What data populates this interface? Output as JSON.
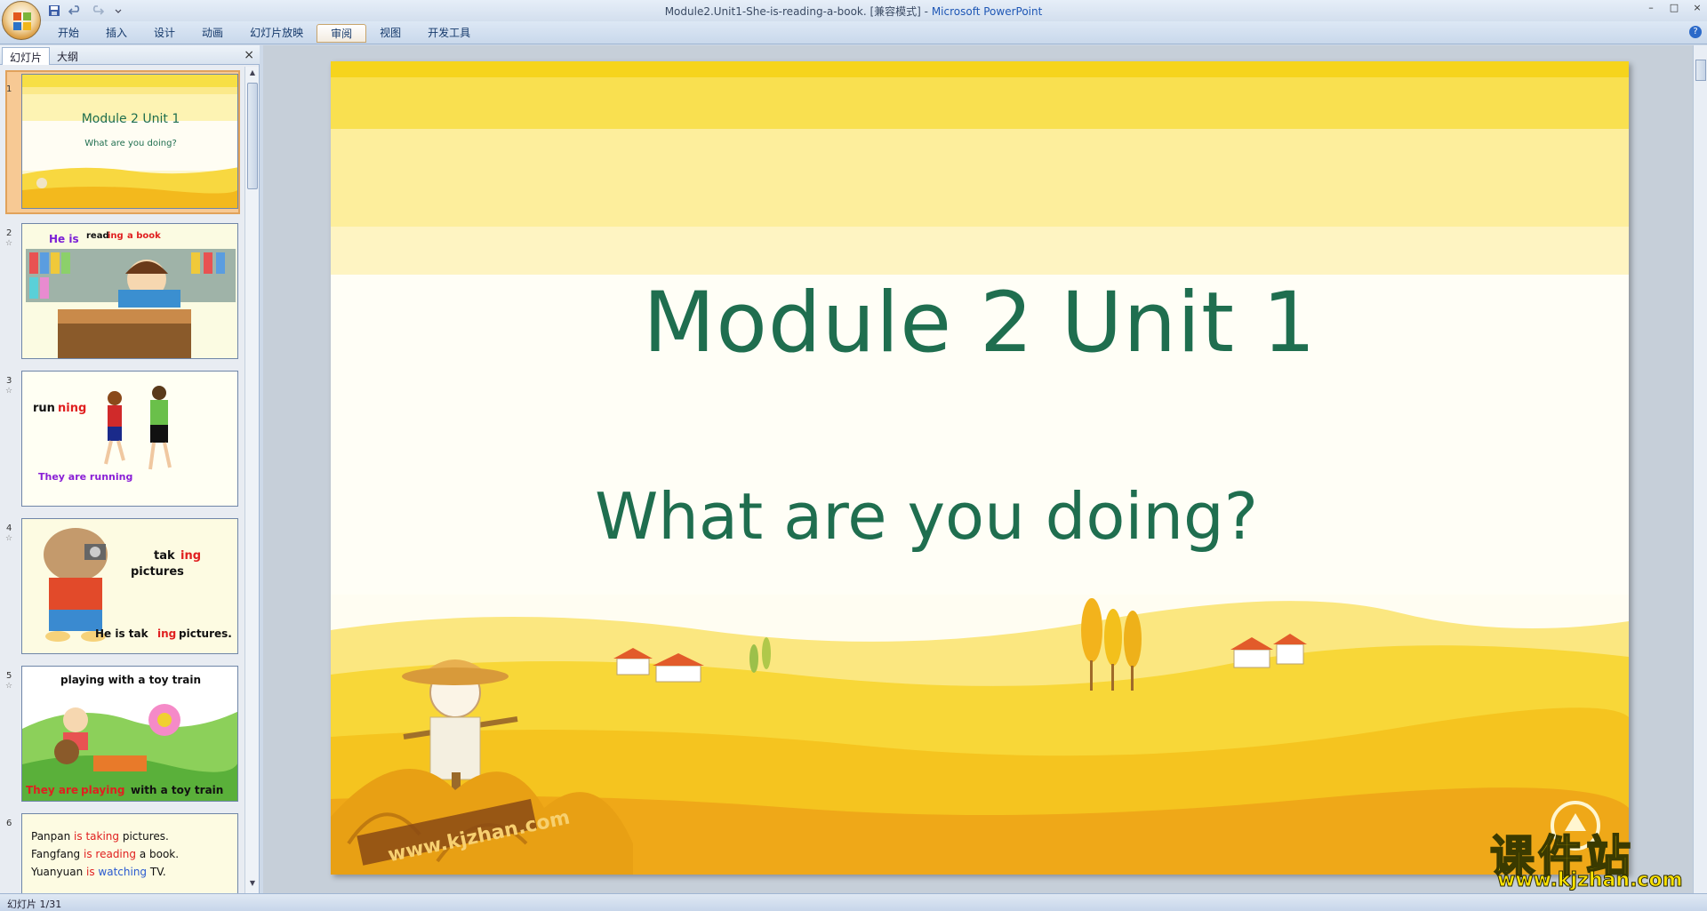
{
  "window": {
    "title_doc": "Module2.Unit1-She-is-reading-a-book. [兼容模式] - ",
    "title_app": "Microsoft PowerPoint",
    "controls": [
      "–",
      "□",
      "×"
    ]
  },
  "ribbon": {
    "tabs": [
      {
        "label": "开始"
      },
      {
        "label": "插入"
      },
      {
        "label": "设计"
      },
      {
        "label": "动画"
      },
      {
        "label": "幻灯片放映"
      },
      {
        "label": "审阅"
      },
      {
        "label": "视图"
      },
      {
        "label": "开发工具"
      }
    ],
    "active_tab": "审阅",
    "help": "?"
  },
  "pane": {
    "tab_slides": "幻灯片",
    "tab_outline": "大纲",
    "close": "×"
  },
  "thumbnails": [
    {
      "num": "1",
      "title": "Module 2 Unit 1",
      "subtitle": "What are you doing?"
    },
    {
      "num": "2",
      "line1a": "He is",
      "line1b": "read",
      "line1c": "ing",
      "line1d": "a book"
    },
    {
      "num": "3",
      "word_a": "run",
      "word_b": "ning",
      "caption": "They are running"
    },
    {
      "num": "4",
      "w1a": "tak",
      "w1b": "ing",
      "w2": "pictures",
      "caption_a": "He is tak",
      "caption_b": "ing",
      "caption_c": "pictures."
    },
    {
      "num": "5",
      "top": "playing with a toy train",
      "cap_a": "They are",
      "cap_b": "playing",
      "cap_c": "with a toy train"
    },
    {
      "num": "6",
      "lines": [
        {
          "a": "Panpan ",
          "b": "is ",
          "c": "taking ",
          "d": "pictures."
        },
        {
          "a": "Fangfang ",
          "b": "is ",
          "c": "reading ",
          "d": "a book."
        },
        {
          "a": "Yuanyuan ",
          "b": "is ",
          "c": "watching ",
          "d": "TV."
        }
      ]
    }
  ],
  "slide": {
    "title": "Module 2 Unit 1",
    "subtitle": "What are you doing?",
    "image_watermark": "www.kjzhan.com"
  },
  "watermark": {
    "text": "课件站",
    "url": "www.kjzhan.com"
  },
  "status": {
    "slide_indicator": "幻灯片 1/31"
  },
  "colors": {
    "title_green": "#1f6e4f",
    "ribbon_blue": "#c9d8eb",
    "field_yellow": "#f7d52a"
  }
}
